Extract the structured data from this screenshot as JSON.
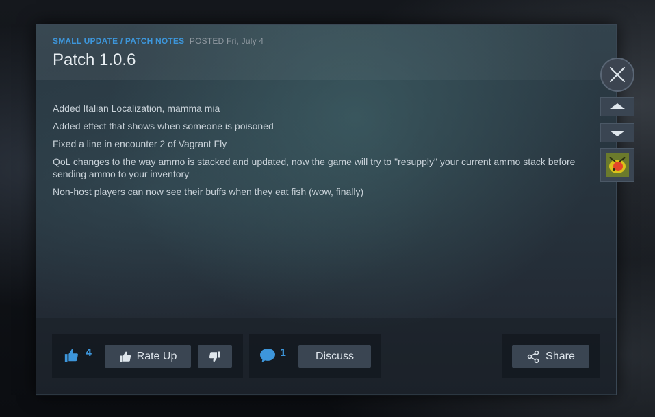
{
  "event": {
    "type_label": "SMALL UPDATE / PATCH NOTES",
    "posted_label": "POSTED",
    "date": "Fri, July 4",
    "title": "Patch 1.0.6"
  },
  "notes": [
    "Added Italian Localization, mamma mia",
    "Added effect that shows when someone is poisoned",
    "Fixed a line in encounter 2 of Vagrant Fly",
    "QoL changes to the way ammo is stacked and updated, now the game will try to \"resupply\" your current ammo stack before sending ammo to your inventory",
    "Non-host players can now see their buffs when they eat fish (wow, finally)"
  ],
  "footer": {
    "rate_count": "4",
    "rate_up_label": "Rate Up",
    "comment_count": "1",
    "discuss_label": "Discuss",
    "share_label": "Share"
  },
  "icons": {
    "close": "close-icon",
    "prev": "chevron-up-icon",
    "next": "chevron-down-icon",
    "game": "game-capsule-icon",
    "thumbs_up": "thumbs-up-icon",
    "thumbs_down": "thumbs-down-icon",
    "comment": "comment-bubble-icon",
    "share": "share-icon"
  },
  "colors": {
    "accent": "#3d96db",
    "button_bg": "#3a4552",
    "text": "#c8d1d8"
  }
}
